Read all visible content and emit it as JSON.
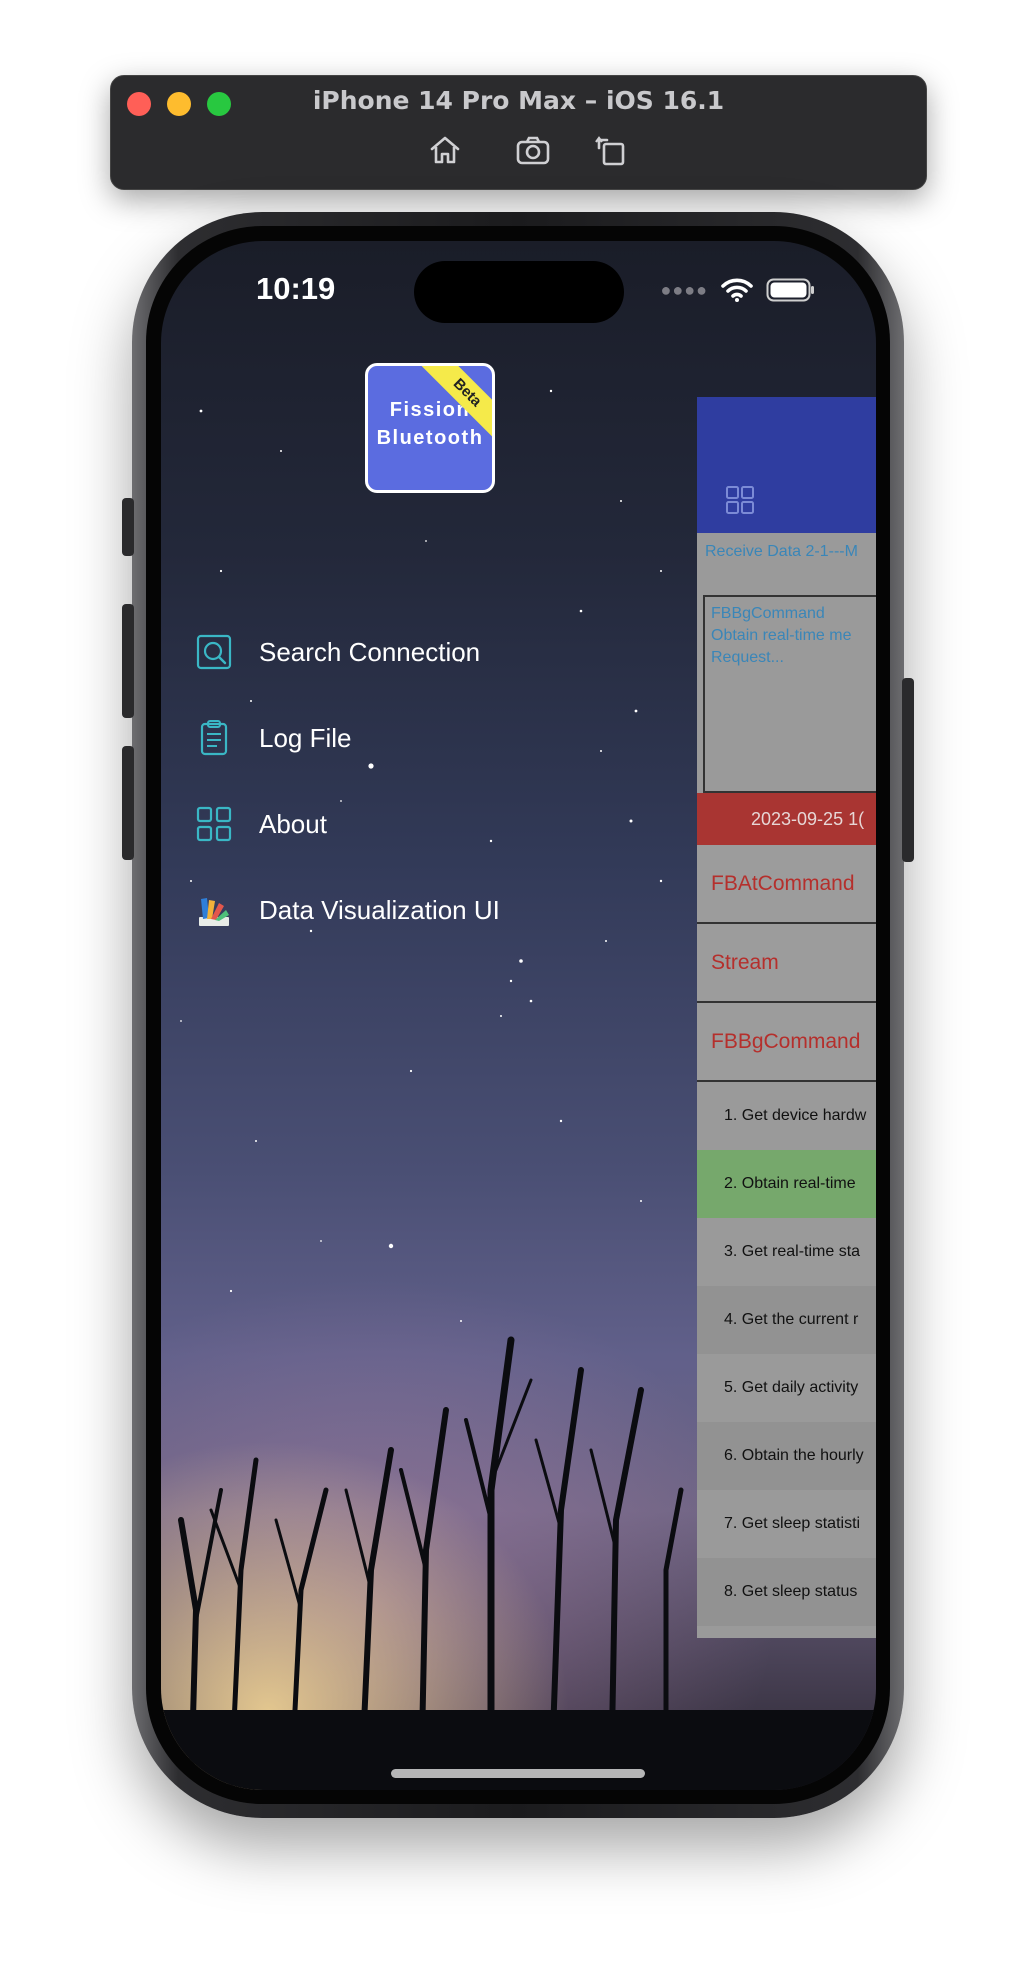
{
  "simulator": {
    "title": "iPhone 14 Pro Max – iOS 16.1",
    "toolbar": [
      "home-icon",
      "screenshot-icon",
      "rotate-icon"
    ]
  },
  "status_bar": {
    "time": "10:19",
    "icons": [
      "signal-dots-icon",
      "wifi-icon",
      "battery-icon"
    ]
  },
  "logo": {
    "line1": "Fission",
    "line2": "Bluetooth",
    "badge": "Beta",
    "color": "#5b6ce0",
    "badge_color": "#f5ea4a"
  },
  "menu": {
    "items": [
      {
        "label": "Search Connection",
        "icon": "search-connection-icon"
      },
      {
        "label": "Log File",
        "icon": "clipboard-icon"
      },
      {
        "label": "About",
        "icon": "grid-icon"
      },
      {
        "label": "Data Visualization UI",
        "icon": "swatch-icon"
      }
    ]
  },
  "panel": {
    "header_color": "#2f3da0",
    "receive_label": "Receive Data 2-1---M",
    "command_lines": [
      "FBBgCommand",
      "Obtain real-time me",
      "Request..."
    ],
    "date": "2023-09-25 1(",
    "tabs": [
      "FBAtCommand",
      "Stream",
      "FBBgCommand"
    ],
    "rows": [
      {
        "label": "1. Get device hardw",
        "highlighted": false
      },
      {
        "label": "2. Obtain real-time",
        "highlighted": true
      },
      {
        "label": "3. Get real-time sta",
        "highlighted": false
      },
      {
        "label": "4. Get the current r",
        "highlighted": false
      },
      {
        "label": "5. Get daily activity",
        "highlighted": false
      },
      {
        "label": "6. Obtain the hourly",
        "highlighted": false
      },
      {
        "label": "7. Get sleep statisti",
        "highlighted": false
      },
      {
        "label": "8. Get sleep status",
        "highlighted": false
      }
    ],
    "accent_red": "#a93532",
    "highlight_green": "#76a86c"
  }
}
